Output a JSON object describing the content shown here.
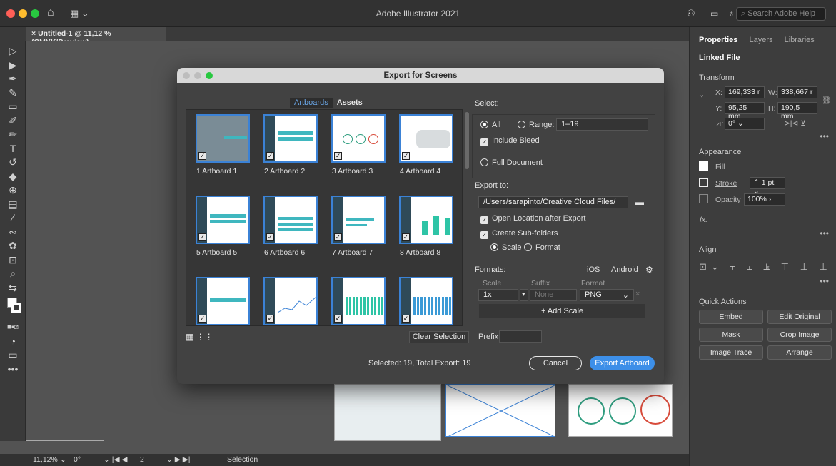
{
  "app": {
    "title": "Adobe Illustrator 2021",
    "search_placeholder": "Search Adobe Help"
  },
  "document": {
    "tab_title": "Untitled-1 @ 11,12 % (CMYK/Preview)"
  },
  "right_panel": {
    "tabs": [
      "Properties",
      "Layers",
      "Libraries"
    ],
    "linked_file": "Linked File",
    "transform": {
      "title": "Transform",
      "x_label": "X:",
      "x": "169,333 r",
      "w_label": "W:",
      "w": "338,667 r",
      "y_label": "Y:",
      "y": "95,25 mm",
      "h_label": "H:",
      "h": "190,5 mm",
      "angle_label": "⊿:",
      "angle": "0°"
    },
    "appearance": {
      "title": "Appearance",
      "fill": "Fill",
      "stroke": "Stroke",
      "stroke_value": "1 pt",
      "opacity": "Opacity",
      "opacity_value": "100%",
      "fx": "fx."
    },
    "align": {
      "title": "Align"
    },
    "quick_actions": {
      "title": "Quick Actions",
      "buttons": [
        "Embed",
        "Edit Original",
        "Mask",
        "Crop Image",
        "Image Trace",
        "Arrange"
      ]
    }
  },
  "status_bar": {
    "zoom": "11,12%",
    "angle": "0°",
    "artboard_index": "2",
    "tool": "Selection"
  },
  "dialog": {
    "title": "Export for Screens",
    "tabs": [
      "Artboards",
      "Assets"
    ],
    "artboards": [
      "1  Artboard 1",
      "2  Artboard 2",
      "3  Artboard 3",
      "4  Artboard 4",
      "5  Artboard 5",
      "6  Artboard 6",
      "7  Artboard 7",
      "8  Artboard 8"
    ],
    "select": {
      "label": "Select:",
      "all": "All",
      "range_label": "Range:",
      "range_value": "1–19",
      "include_bleed": "Include Bleed",
      "full_document": "Full Document"
    },
    "export_to": {
      "label": "Export to:",
      "path": "/Users/sarapinto/Creative Cloud Files/",
      "open_location": "Open Location after Export",
      "create_subfolders": "Create Sub-folders",
      "scale": "Scale",
      "format": "Format"
    },
    "formats": {
      "label": "Formats:",
      "ios": "iOS",
      "android": "Android",
      "col_scale": "Scale",
      "col_suffix": "Suffix",
      "col_format": "Format",
      "scale_value": "1x",
      "suffix_placeholder": "None",
      "format_value": "PNG",
      "add_scale": "+ Add Scale"
    },
    "clear_selection": "Clear Selection",
    "prefix_label": "Prefix:",
    "summary": "Selected: 19, Total Export: 19",
    "cancel": "Cancel",
    "export": "Export Artboard"
  }
}
